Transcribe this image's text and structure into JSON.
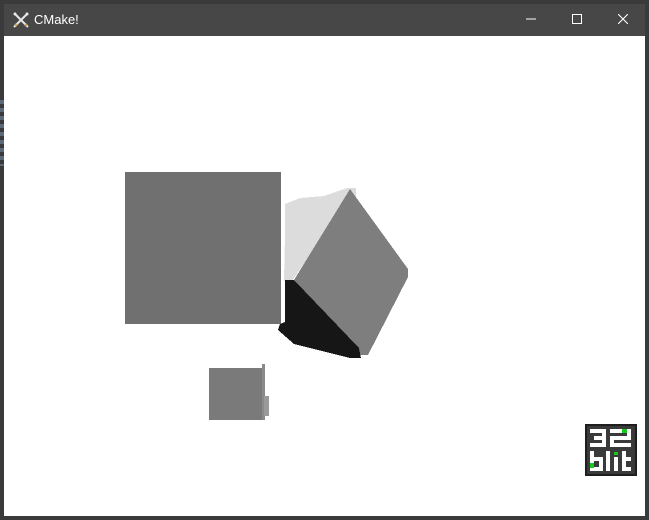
{
  "window": {
    "title": "CMake!",
    "icon": "crossed-swords-icon",
    "controls": {
      "minimize": "minimize-icon",
      "maximize": "maximize-icon",
      "close": "close-icon"
    }
  },
  "viewport": {
    "background": "#ffffff",
    "shapes": [
      "gray-square",
      "rotated-cube",
      "small-gray-square"
    ],
    "colors": {
      "square": "#707070",
      "cube_top": "#dcdcdc",
      "cube_front": "#7e7e7e",
      "cube_bottom": "#161616",
      "small_square": "#7a7a7a"
    }
  },
  "logo": {
    "text": "32blit",
    "icon": "32blit-logo-icon",
    "accent": "#19c81e"
  }
}
